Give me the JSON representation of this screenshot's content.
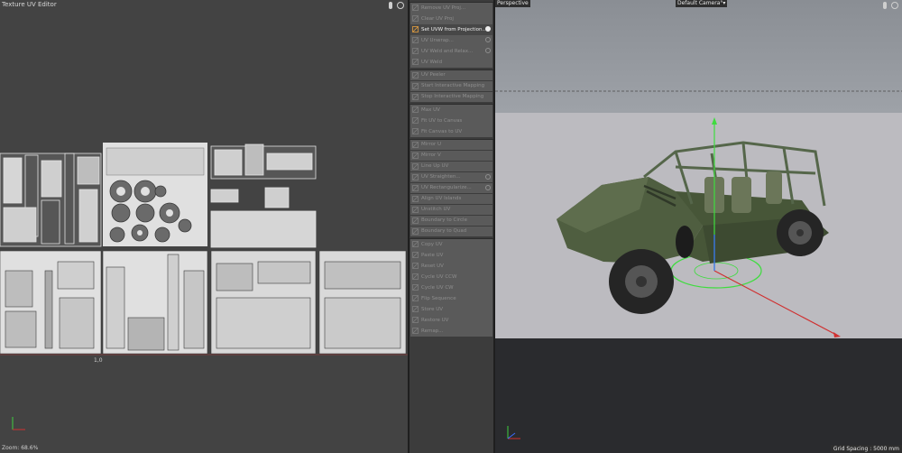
{
  "uv_editor": {
    "title": "Texture UV Editor",
    "zoom_label": "Zoom: 68.6%",
    "uv_coord_label": "1,0"
  },
  "command_groups": [
    {
      "items": [
        {
          "label": "Remove UV Proj...",
          "icon": "remove-uv-icon",
          "gear": false,
          "active": false
        },
        {
          "label": "Clear UV Proj",
          "icon": "clear-uv-icon",
          "gear": false,
          "active": false
        },
        {
          "label": "Set UVW from Projection...",
          "icon": "set-uvw-icon",
          "gear": true,
          "active": true
        },
        {
          "label": "UV Unwrap...",
          "icon": "uv-unwrap-icon",
          "gear": true,
          "active": false
        },
        {
          "label": "UV Weld and Relax...",
          "icon": "uv-weld-relax-icon",
          "gear": true,
          "active": false
        },
        {
          "label": "UV Weld",
          "icon": "uv-weld-icon",
          "gear": false,
          "active": false
        }
      ]
    },
    {
      "items": [
        {
          "label": "UV Peeler",
          "icon": "uv-peeler-icon",
          "gear": false,
          "active": false
        },
        {
          "label": "Start Interactive Mapping",
          "icon": "start-mapping-icon",
          "gear": false,
          "active": false
        },
        {
          "label": "Stop Interactive Mapping",
          "icon": "stop-mapping-icon",
          "gear": false,
          "active": false
        }
      ]
    },
    {
      "items": [
        {
          "label": "Max UV",
          "icon": "max-uv-icon",
          "gear": false,
          "active": false
        },
        {
          "label": "Fit UV to Canvas",
          "icon": "fit-uv-icon",
          "gear": false,
          "active": false
        },
        {
          "label": "Fit Canvas to UV",
          "icon": "fit-canvas-icon",
          "gear": false,
          "active": false
        }
      ]
    },
    {
      "items": [
        {
          "label": "Mirror U",
          "icon": "mirror-u-icon",
          "gear": false,
          "active": false
        },
        {
          "label": "Mirror V",
          "icon": "mirror-v-icon",
          "gear": false,
          "active": false
        },
        {
          "label": "Line Up UV",
          "icon": "line-up-uv-icon",
          "gear": false,
          "active": false
        },
        {
          "label": "UV Straighten...",
          "icon": "uv-straighten-icon",
          "gear": true,
          "active": false
        },
        {
          "label": "UV Rectangularize...",
          "icon": "uv-rectangularize-icon",
          "gear": true,
          "active": false
        },
        {
          "label": "Align UV Islands",
          "icon": "align-islands-icon",
          "gear": false,
          "active": false
        },
        {
          "label": "Unstitch UV",
          "icon": "unstitch-uv-icon",
          "gear": false,
          "active": false
        },
        {
          "label": "Boundary to Circle",
          "icon": "boundary-circle-icon",
          "gear": false,
          "active": false
        },
        {
          "label": "Boundary to Quad",
          "icon": "boundary-quad-icon",
          "gear": false,
          "active": false
        }
      ]
    },
    {
      "items": [
        {
          "label": "Copy UV",
          "icon": "copy-uv-icon",
          "gear": false,
          "active": false
        },
        {
          "label": "Paste UV",
          "icon": "paste-uv-icon",
          "gear": false,
          "active": false
        },
        {
          "label": "Reset UV",
          "icon": "reset-uv-icon",
          "gear": false,
          "active": false
        },
        {
          "label": "Cycle UV CCW",
          "icon": "cycle-ccw-icon",
          "gear": false,
          "active": false
        },
        {
          "label": "Cycle UV CW",
          "icon": "cycle-cw-icon",
          "gear": false,
          "active": false
        },
        {
          "label": "Flip Sequence",
          "icon": "flip-sequence-icon",
          "gear": false,
          "active": false
        },
        {
          "label": "Store UV",
          "icon": "store-uv-icon",
          "gear": false,
          "active": false
        },
        {
          "label": "Restore UV",
          "icon": "restore-uv-icon",
          "gear": false,
          "active": false
        },
        {
          "label": "Remap...",
          "icon": "remap-icon",
          "gear": false,
          "active": false
        }
      ]
    }
  ],
  "viewport": {
    "view_name": "Perspective",
    "camera_name": "Default Camera",
    "camera_mark": "°▾",
    "grid_spacing": "Grid Spacing : 5000 mm"
  },
  "colors": {
    "uv_background": "#434343",
    "uv_islands": "#e2e2e2",
    "active_command": "#474747",
    "vehicle_green": "#4f5e40",
    "gizmo_green": "#3fdc3f",
    "gizmo_red": "#d03030",
    "gizmo_blue": "#3a6cff"
  }
}
